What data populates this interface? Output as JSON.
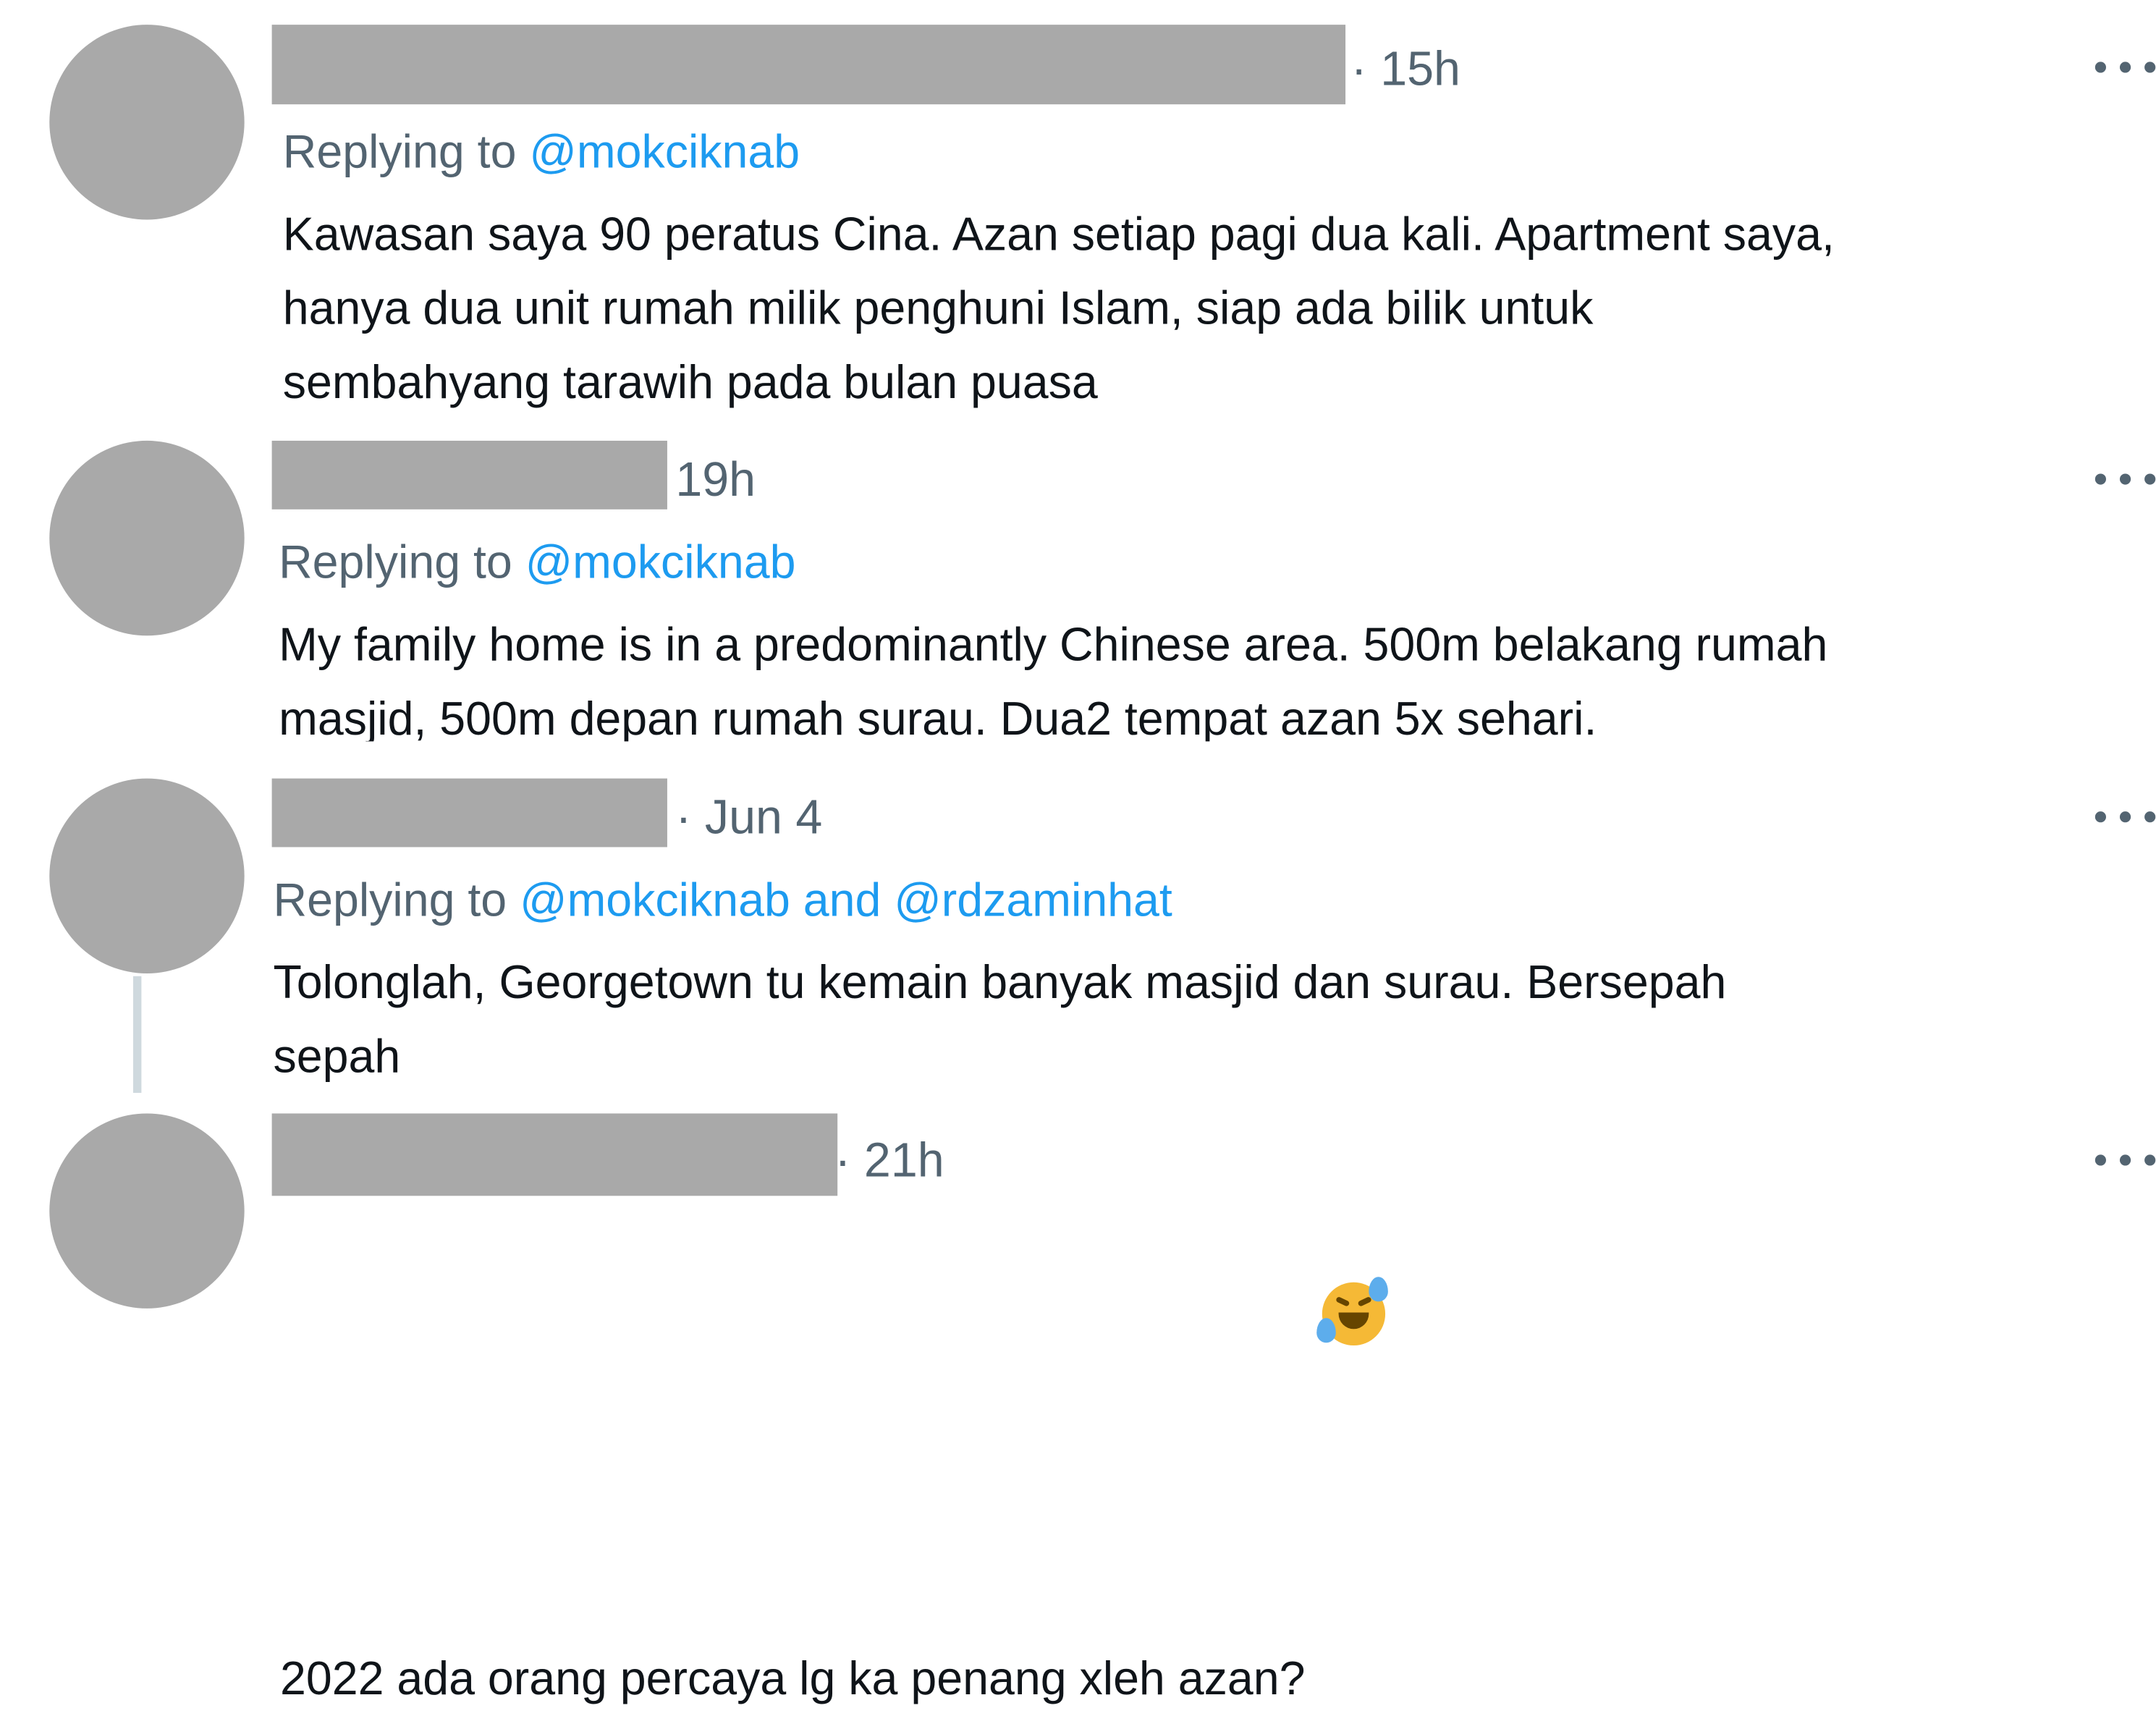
{
  "replies": [
    {
      "time": "· 15h",
      "replying_prefix": "Replying to ",
      "replying_mentions": "@mokciknab",
      "text": "Kawasan saya 90 peratus Cina. Azan setiap pagi dua kali. Apartment saya,\nhanya dua unit rumah milik penghuni Islam, siap ada bilik untuk\nsembahyang tarawih pada bulan puasa"
    },
    {
      "time": "19h",
      "replying_prefix": "Replying to ",
      "replying_mentions": "@mokciknab",
      "text": "My family home is in a predominantly Chinese area. 500m belakang rumah\nmasjid, 500m depan rumah surau. Dua2 tempat azan 5x sehari."
    },
    {
      "time": "· Jun 4",
      "replying_prefix": "Replying to ",
      "replying_mentions": "@mokciknab and @rdzaminhat",
      "text": "Tolonglah, Georgetown tu kemain banyak masjid dan surau. Bersepah\nsepah"
    },
    {
      "time": "· 21h",
      "text": "2022 ada orang percaya lg ka penang xleh azan?",
      "emoji": "rolling-on-floor-laughing-emoji"
    }
  ],
  "colors": {
    "redaction": "#a9a9a9",
    "secondary_text": "#536471",
    "mention": "#1d9bf0",
    "primary_text": "#0f1419",
    "thread_line": "#cfd9de"
  }
}
